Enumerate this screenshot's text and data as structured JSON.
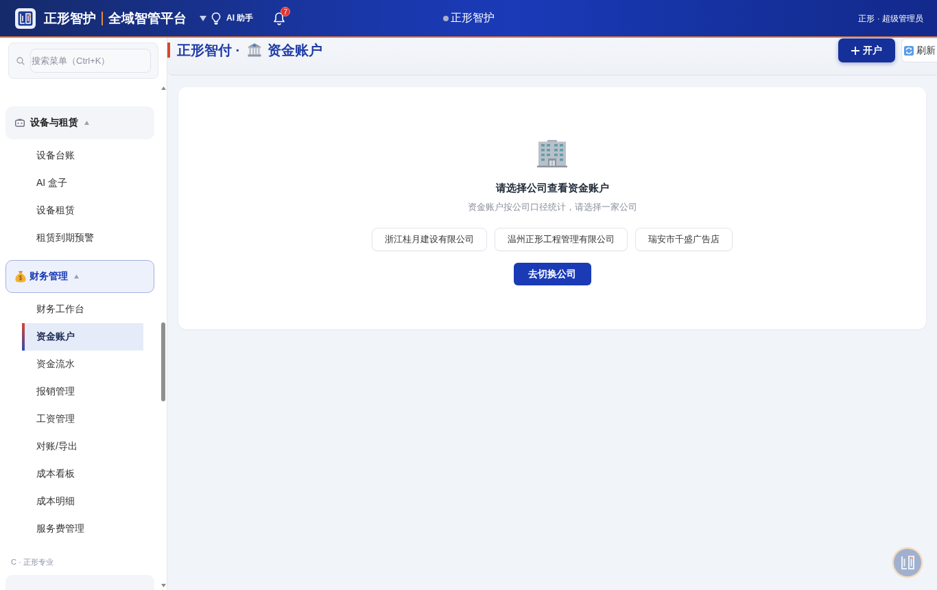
{
  "header": {
    "brand": "正形智护",
    "platform": "全域智管平台",
    "assistant": "AI 助手",
    "notification_count": "7",
    "center_title": "正形智护",
    "user": "正形 · 超级管理员"
  },
  "sidebar": {
    "search": {
      "placeholder": "搜索菜单（Ctrl+K）"
    },
    "groups": [
      {
        "label": "设备与租赁",
        "selected": false,
        "expanded": true,
        "children": [
          {
            "label": "设备台账",
            "selected": false
          },
          {
            "label": "AI 盒子",
            "selected": false
          },
          {
            "label": "设备租赁",
            "selected": false
          },
          {
            "label": "租赁到期预警",
            "selected": false
          }
        ]
      },
      {
        "label": "财务管理",
        "selected": true,
        "expanded": true,
        "children": [
          {
            "label": "财务工作台",
            "selected": false
          },
          {
            "label": "资金账户",
            "selected": true
          },
          {
            "label": "资金流水",
            "selected": false
          },
          {
            "label": "报销管理",
            "selected": false
          },
          {
            "label": "工资管理",
            "selected": false
          },
          {
            "label": "对账/导出",
            "selected": false
          },
          {
            "label": "成本看板",
            "selected": false
          },
          {
            "label": "成本明细",
            "selected": false
          },
          {
            "label": "服务费管理",
            "selected": false
          }
        ]
      }
    ],
    "section_label": "C · 正形专业"
  },
  "page": {
    "brand": "正形智付 ·",
    "title": "资金账户",
    "actions": [
      {
        "label": "开户",
        "kind": "primary"
      },
      {
        "label": "刷新",
        "kind": "secondary"
      }
    ]
  },
  "empty_state": {
    "title": "请选择公司查看资金账户",
    "description": "资金账户按公司口径统计，请选择一家公司",
    "companies": [
      "浙江桂月建设有限公司",
      "温州正形工程管理有限公司",
      "瑞安市千盛广告店"
    ],
    "action": "去切换公司"
  }
}
